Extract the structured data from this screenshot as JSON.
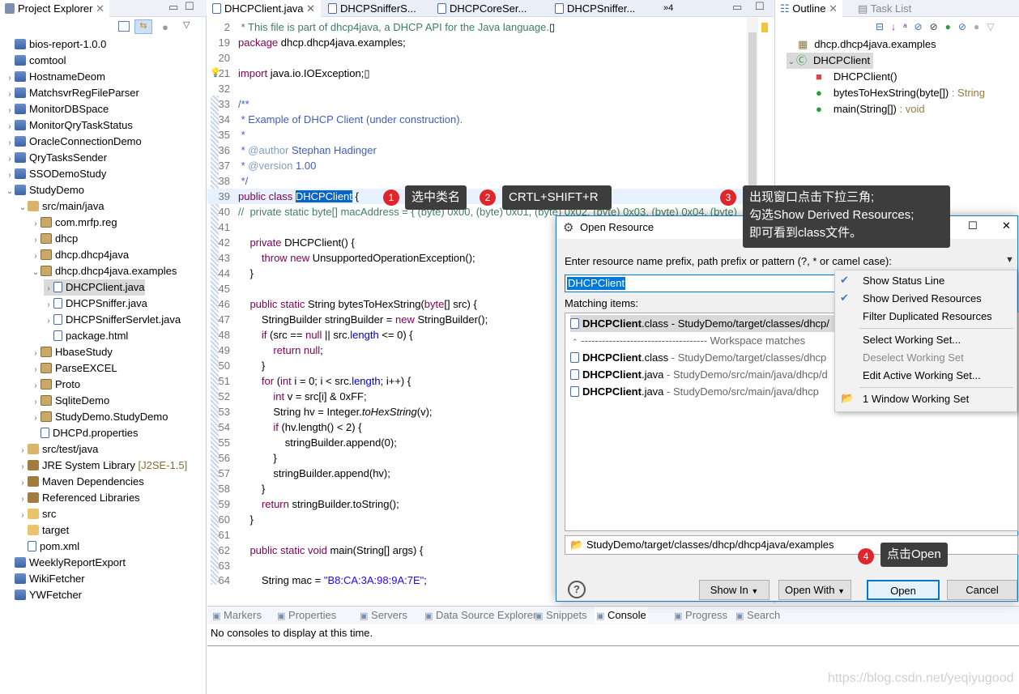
{
  "project_explorer": {
    "title": "Project Explorer",
    "items": [
      {
        "label": "bios-report-1.0.0",
        "level": 0,
        "icon": "project-icon",
        "twisty": ""
      },
      {
        "label": "comtool",
        "level": 0,
        "icon": "project-icon",
        "twisty": ""
      },
      {
        "label": "HostnameDeom",
        "level": 0,
        "icon": "project-icon",
        "twisty": ">"
      },
      {
        "label": "MatchsvrRegFileParser",
        "level": 0,
        "icon": "project-icon",
        "twisty": ">"
      },
      {
        "label": "MonitorDBSpace",
        "level": 0,
        "icon": "project-icon",
        "twisty": ">"
      },
      {
        "label": "MonitorQryTaskStatus",
        "level": 0,
        "icon": "project-icon",
        "twisty": ">"
      },
      {
        "label": "OracleConnectionDemo",
        "level": 0,
        "icon": "project-icon",
        "twisty": ">"
      },
      {
        "label": "QryTasksSender",
        "level": 0,
        "icon": "project-icon",
        "twisty": ">"
      },
      {
        "label": "SSODemoStudy",
        "level": 0,
        "icon": "project-icon",
        "twisty": ">"
      },
      {
        "label": "StudyDemo",
        "level": 0,
        "icon": "project-icon",
        "twisty": "v"
      },
      {
        "label": "src/main/java",
        "level": 1,
        "icon": "source-folder-icon",
        "twisty": "v"
      },
      {
        "label": "com.mrfp.reg",
        "level": 2,
        "icon": "package-icon",
        "twisty": ">"
      },
      {
        "label": "dhcp",
        "level": 2,
        "icon": "package-icon",
        "twisty": ">"
      },
      {
        "label": "dhcp.dhcp4java",
        "level": 2,
        "icon": "package-icon",
        "twisty": ">"
      },
      {
        "label": "dhcp.dhcp4java.examples",
        "level": 2,
        "icon": "package-icon",
        "twisty": "v"
      },
      {
        "label": "DHCPClient.java",
        "level": 3,
        "icon": "java-file-icon",
        "twisty": ">",
        "selected": true
      },
      {
        "label": "DHCPSniffer.java",
        "level": 3,
        "icon": "java-file-icon",
        "twisty": ">"
      },
      {
        "label": "DHCPSnifferServlet.java",
        "level": 3,
        "icon": "java-file-icon",
        "twisty": ">"
      },
      {
        "label": "package.html",
        "level": 3,
        "icon": "html-file-icon",
        "twisty": ""
      },
      {
        "label": "HbaseStudy",
        "level": 2,
        "icon": "package-icon",
        "twisty": ">"
      },
      {
        "label": "ParseEXCEL",
        "level": 2,
        "icon": "package-icon",
        "twisty": ">"
      },
      {
        "label": "Proto",
        "level": 2,
        "icon": "package-icon",
        "twisty": ">"
      },
      {
        "label": "SqliteDemo",
        "level": 2,
        "icon": "package-icon",
        "twisty": ">"
      },
      {
        "label": "StudyDemo.StudyDemo",
        "level": 2,
        "icon": "package-icon",
        "twisty": ">"
      },
      {
        "label": "DHCPd.properties",
        "level": 2,
        "icon": "file-icon",
        "twisty": ""
      },
      {
        "label": "src/test/java",
        "level": 1,
        "icon": "source-folder-icon",
        "twisty": ">"
      },
      {
        "label": "JRE System Library",
        "suffix": "[J2SE-1.5]",
        "level": 1,
        "icon": "library-icon",
        "twisty": ">"
      },
      {
        "label": "Maven Dependencies",
        "level": 1,
        "icon": "library-icon",
        "twisty": ">"
      },
      {
        "label": "Referenced Libraries",
        "level": 1,
        "icon": "library-icon",
        "twisty": ">"
      },
      {
        "label": "src",
        "level": 1,
        "icon": "folder-icon",
        "twisty": ">"
      },
      {
        "label": "target",
        "level": 1,
        "icon": "folder-icon",
        "twisty": ""
      },
      {
        "label": "pom.xml",
        "level": 1,
        "icon": "xml-file-icon",
        "twisty": ""
      },
      {
        "label": "WeeklyReportExport",
        "level": 0,
        "icon": "project-icon",
        "twisty": ""
      },
      {
        "label": "WikiFetcher",
        "level": 0,
        "icon": "project-icon",
        "twisty": ""
      },
      {
        "label": "YWFetcher",
        "level": 0,
        "icon": "project-icon",
        "twisty": ""
      }
    ]
  },
  "editor": {
    "tabs": [
      "DHCPClient.java",
      "DHCPSnifferS...",
      "DHCPCoreSer...",
      "DHCPSniffer..."
    ],
    "overflow": "»4",
    "lines": [
      {
        "n": "2",
        "html": "<span class='cm'> * This file is part of dhcp4java, a DHCP API for the Java language.</span>▯"
      },
      {
        "n": "19",
        "html": "<span class='kw'>package</span> dhcp.dhcp4java.examples;"
      },
      {
        "n": "20",
        "html": ""
      },
      {
        "n": "21",
        "html": "<span class='kw'>import</span> java.io.IOException;▯"
      },
      {
        "n": "32",
        "html": ""
      },
      {
        "n": "33",
        "html": "<span class='doc'>/**</span>"
      },
      {
        "n": "34",
        "html": "<span class='doc'> * Example of DHCP Client (under construction).</span>"
      },
      {
        "n": "35",
        "html": "<span class='doc'> *</span>"
      },
      {
        "n": "36",
        "html": "<span class='doc'> * <b style='font-weight:normal;color:#7f9fbf'>@author</b> Stephan Hadinger</span>"
      },
      {
        "n": "37",
        "html": "<span class='doc'> * <span style='color:#7f9fbf'>@version</span> 1.00</span>"
      },
      {
        "n": "38",
        "html": "<span class='doc'> */</span>"
      },
      {
        "n": "39",
        "html": "<span class='kw'>public class</span> <span style='background:#0a64c8;color:#fff'>DHCPClient</span> {"
      },
      {
        "n": "40",
        "html": "<span class='cm'>//  private static byte[] macAddress = { (byte) 0x00, (byte) 0x01, (byte) 0x02, (byte) 0x03, (byte) 0x04, (byte)</span>"
      },
      {
        "n": "41",
        "html": ""
      },
      {
        "n": "42",
        "html": "    <span class='kw'>private</span> DHCPClient() {"
      },
      {
        "n": "43",
        "html": "        <span class='kw'>throw new</span> UnsupportedOperationException();"
      },
      {
        "n": "44",
        "html": "    }"
      },
      {
        "n": "45",
        "html": ""
      },
      {
        "n": "46",
        "html": "    <span class='kw'>public static</span> String bytesToHexString(<span class='kw'>byte</span>[] src) {"
      },
      {
        "n": "47",
        "html": "        StringBuilder stringBuilder = <span class='kw'>new</span> StringBuilder();"
      },
      {
        "n": "48",
        "html": "        <span class='kw'>if</span> (src == <span class='kw'>null</span> || src.<span class='fld'>length</span> &lt;= 0) {"
      },
      {
        "n": "49",
        "html": "            <span class='kw'>return null</span>;"
      },
      {
        "n": "50",
        "html": "        }"
      },
      {
        "n": "51",
        "html": "        <span class='kw'>for</span> (<span class='kw'>int</span> i = 0; i &lt; src.<span class='fld'>length</span>; i++) {"
      },
      {
        "n": "52",
        "html": "            <span class='kw'>int</span> v = src[i] &amp; 0xFF;"
      },
      {
        "n": "53",
        "html": "            String hv = Integer.<span class='it'>toHexString</span>(v);"
      },
      {
        "n": "54",
        "html": "            <span class='kw'>if</span> (hv.length() &lt; 2) {"
      },
      {
        "n": "55",
        "html": "                stringBuilder.append(0);"
      },
      {
        "n": "56",
        "html": "            }"
      },
      {
        "n": "57",
        "html": "            stringBuilder.append(hv);"
      },
      {
        "n": "58",
        "html": "        }"
      },
      {
        "n": "59",
        "html": "        <span class='kw'>return</span> stringBuilder.toString();"
      },
      {
        "n": "60",
        "html": "    }"
      },
      {
        "n": "61",
        "html": ""
      },
      {
        "n": "62",
        "html": "    <span class='kw'>public static void</span> main(String[] args) {"
      },
      {
        "n": "63",
        "html": ""
      },
      {
        "n": "64",
        "html": "        String mac = <span class='str'>\"B8:CA:3A:98:9A:7E\"</span>;"
      }
    ]
  },
  "outline": {
    "tabs": [
      "Outline",
      "Task List"
    ],
    "items": [
      {
        "label": "dhcp.dhcp4java.examples",
        "type": ""
      },
      {
        "label": "DHCPClient",
        "type": ""
      },
      {
        "label": "DHCPClient()",
        "type": ""
      },
      {
        "label": "bytesToHexString(byte[])",
        "type": " : String"
      },
      {
        "label": "main(String[])",
        "type": " : void"
      }
    ]
  },
  "bottom": {
    "tabs": [
      "Markers",
      "Properties",
      "Servers",
      "Data Source Explorer",
      "Snippets",
      "Console",
      "Progress",
      "Search"
    ],
    "console_text": "No consoles to display at this time."
  },
  "dialog": {
    "title": "Open Resource",
    "prompt": "Enter resource name prefix, path prefix or pattern (?, * or camel case):",
    "input_value": "DHCPClient",
    "matching_label": "Matching items:",
    "results": [
      {
        "name": "DHCPClient",
        "ext": ".class",
        "path": " - StudyDemo/target/classes/dhcp/",
        "icon": "class-file-icon",
        "selected": true
      },
      {
        "separator": "------------------------------------ Workspace matches"
      },
      {
        "name": "DHCPClient",
        "ext": ".class",
        "path": " - StudyDemo/target/classes/dhcp",
        "icon": "class-file-icon"
      },
      {
        "name": "DHCPClient",
        "ext": ".java",
        "path": " - StudyDemo/src/main/java/dhcp/d",
        "icon": "java-file-icon"
      },
      {
        "name": "DHCPClient",
        "ext": ".java",
        "path": " - StudyDemo/src/main/java/dhcp",
        "icon": "java-file-icon"
      }
    ],
    "status_line": "StudyDemo/target/classes/dhcp/dhcp4java/examples",
    "buttons": {
      "show_in": "Show In",
      "open_with": "Open With",
      "open": "Open",
      "cancel": "Cancel"
    },
    "menu": [
      {
        "label": "Show Status Line",
        "checked": true
      },
      {
        "label": "Show Derived Resources",
        "checked": true
      },
      {
        "label": "Filter Duplicated Resources"
      },
      {
        "sep": true
      },
      {
        "label": "Select Working Set..."
      },
      {
        "label": "Deselect Working Set",
        "disabled": true
      },
      {
        "label": "Edit Active Working Set..."
      },
      {
        "sep": true
      },
      {
        "label": "1 Window Working Set",
        "icon": true
      }
    ]
  },
  "callouts": [
    {
      "num": "1",
      "text": "选中类名"
    },
    {
      "num": "2",
      "text": "CRTL+SHIFT+R"
    },
    {
      "num": "3",
      "lines": [
        "出现窗口点击下拉三角;",
        "勾选Show Derived Resources;",
        "即可看到class文件。"
      ]
    },
    {
      "num": "4",
      "text": "点击Open"
    }
  ],
  "watermark": "https://blog.csdn.net/yeqiyugood",
  "colors": {
    "accent": "#0078d7",
    "callout_bg": "#3d3d3d",
    "badge": "#e0262a"
  }
}
